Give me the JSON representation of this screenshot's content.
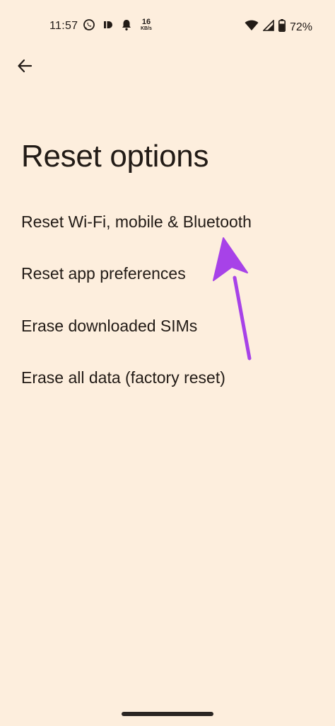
{
  "status_bar": {
    "time": "11:57",
    "net_speed_value": "16",
    "net_speed_unit": "KB/s",
    "battery_percent": "72%",
    "icons_left": [
      "whatsapp-icon",
      "app-notification-icon",
      "bell-icon"
    ],
    "icons_right": [
      "wifi-icon",
      "cellular-signal-icon",
      "battery-icon"
    ]
  },
  "header": {
    "back_icon": "arrow-back-icon"
  },
  "page": {
    "title": "Reset options"
  },
  "options": [
    {
      "label": "Reset Wi-Fi, mobile & Bluetooth"
    },
    {
      "label": "Reset app preferences"
    },
    {
      "label": "Erase downloaded SIMs"
    },
    {
      "label": "Erase all data (factory reset)"
    }
  ],
  "colors": {
    "background": "#fdeedd",
    "text": "#221b16",
    "annotation_arrow": "#a742e8"
  }
}
